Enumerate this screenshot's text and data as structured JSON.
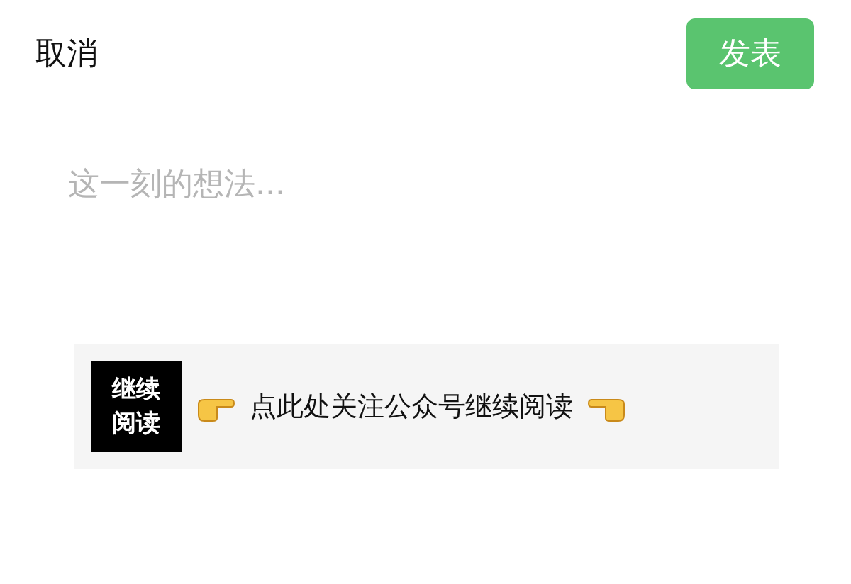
{
  "header": {
    "cancel": "取消",
    "publish": "发表"
  },
  "composer": {
    "placeholder": "这一刻的想法..."
  },
  "banner": {
    "badge": [
      "继续",
      "阅读"
    ],
    "text": "点此处关注公众号继续阅读"
  }
}
